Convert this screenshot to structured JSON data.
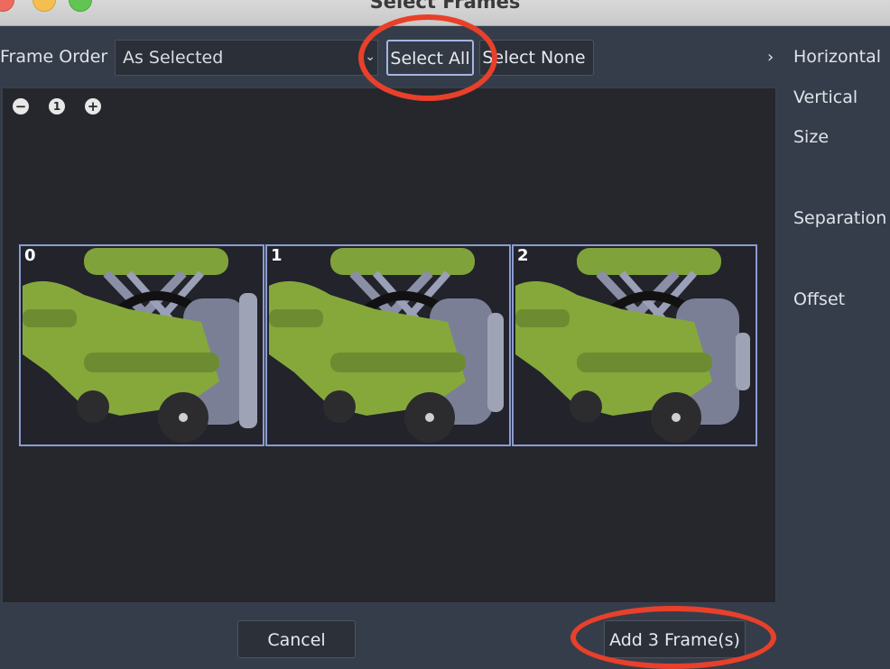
{
  "window": {
    "title": "Select Frames"
  },
  "toolbar": {
    "frame_order_label": "Frame Order",
    "frame_order_value": "As Selected",
    "select_all_label": "Select All",
    "select_none_label": "Select None"
  },
  "viewport": {
    "zoom_icons": [
      "zoom-out-icon",
      "zoom-reset-icon",
      "zoom-in-icon"
    ],
    "frames": [
      {
        "index": "0",
        "selected": true
      },
      {
        "index": "1",
        "selected": true
      },
      {
        "index": "2",
        "selected": true
      }
    ]
  },
  "right_panel": {
    "horizontal_label": "Horizontal",
    "vertical_label": "Vertical",
    "size_label": "Size",
    "separation_label": "Separation",
    "offset_label": "Offset"
  },
  "footer": {
    "cancel_label": "Cancel",
    "add_label": "Add 3 Frame(s)"
  },
  "colors": {
    "annotation": "#e8402a",
    "selection": "#8c9bd0",
    "background": "#363d4a"
  }
}
